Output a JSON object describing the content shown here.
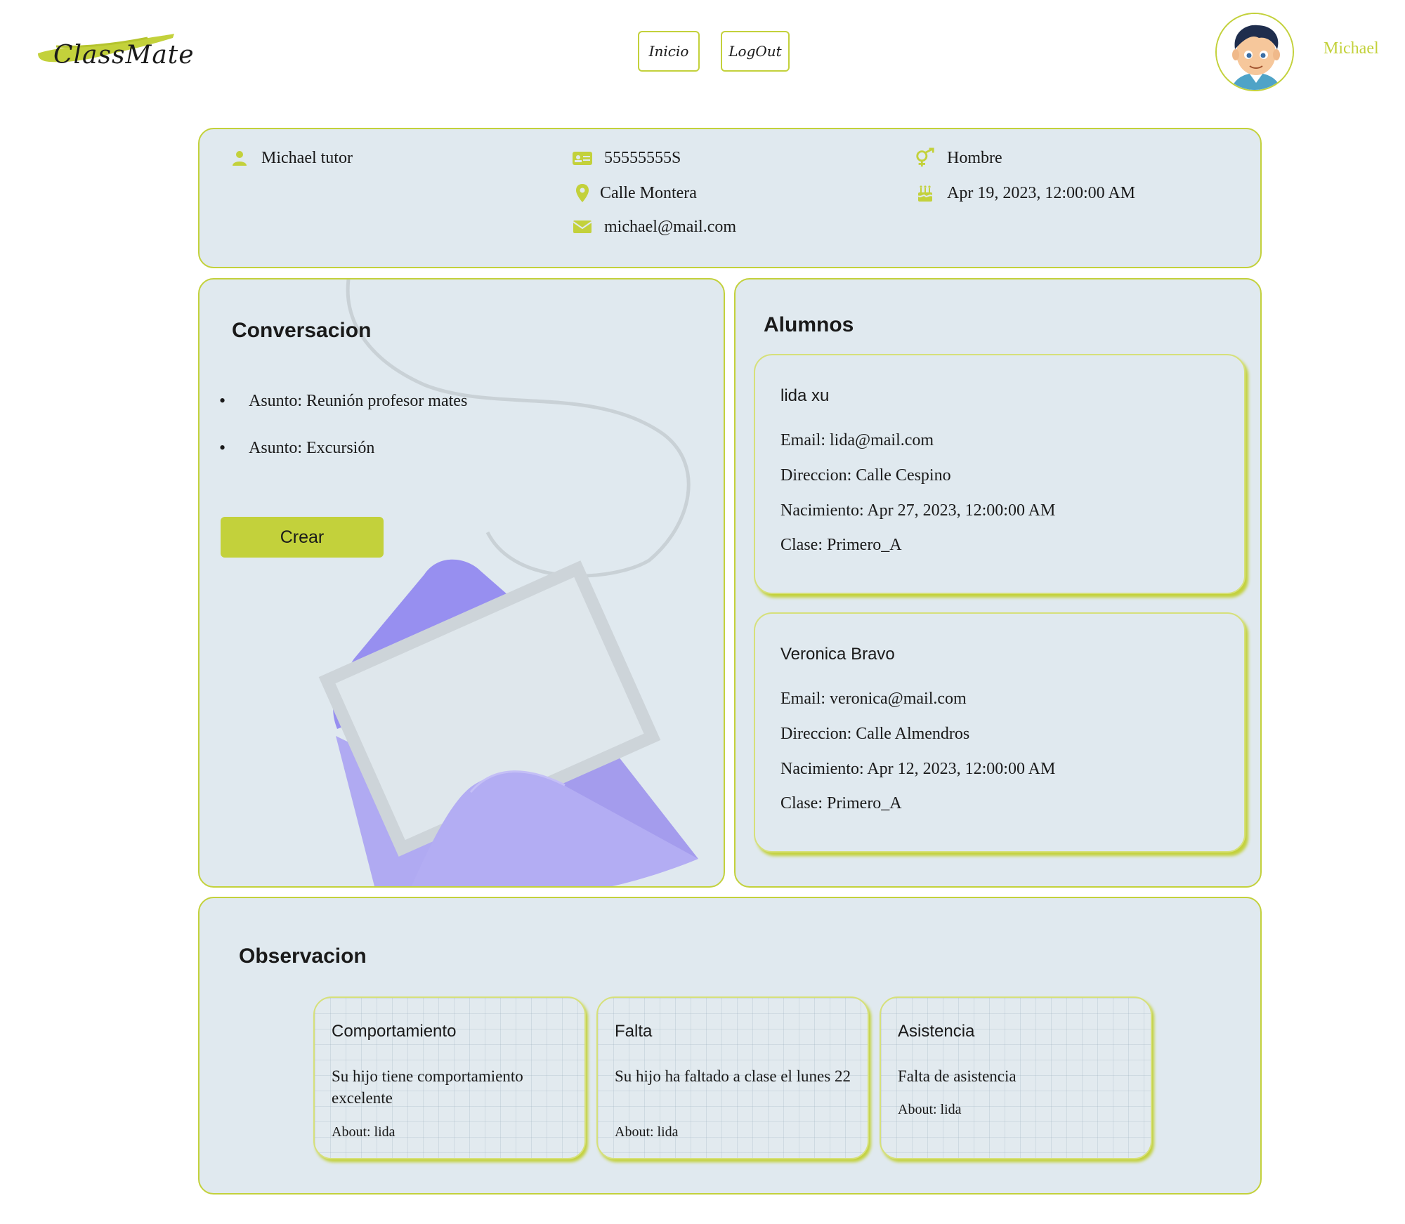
{
  "header": {
    "logo_text": "ClassMate",
    "nav": {
      "inicio": "Inicio",
      "logout": "LogOut"
    },
    "user_name": "Michael"
  },
  "profile": {
    "name": "Michael tutor",
    "dni": "55555555S",
    "address": "Calle Montera",
    "email": "michael@mail.com",
    "gender": "Hombre",
    "birthdate": "Apr 19, 2023, 12:00:00 AM"
  },
  "conversacion": {
    "title": "Conversacion",
    "items": [
      "Asunto: Reunión profesor mates",
      "Asunto: Excursión"
    ],
    "create_label": "Crear"
  },
  "alumnos": {
    "title": "Alumnos",
    "students": [
      {
        "name": "lida xu",
        "email": "Email: lida@mail.com",
        "address": "Direccion: Calle Cespino",
        "birth": "Nacimiento: Apr 27, 2023, 12:00:00 AM",
        "clase": "Clase: Primero_A"
      },
      {
        "name": "Veronica Bravo",
        "email": "Email: veronica@mail.com",
        "address": "Direccion: Calle Almendros",
        "birth": "Nacimiento: Apr 12, 2023, 12:00:00 AM",
        "clase": "Clase: Primero_A"
      }
    ]
  },
  "observacion": {
    "title": "Observacion",
    "cards": [
      {
        "type": "Comportamiento",
        "text": "Su hijo tiene comportamiento excelente",
        "about": "About: lida"
      },
      {
        "type": "Falta",
        "text": "Su hijo ha faltado a clase el lunes 22",
        "about": "About: lida"
      },
      {
        "type": "Asistencia",
        "text": "Falta de asistencia",
        "about": "About: lida"
      }
    ]
  },
  "colors": {
    "accent": "#c3d13b",
    "panel_bg": "#e0e9ef",
    "envelope": "#a79ff0"
  }
}
